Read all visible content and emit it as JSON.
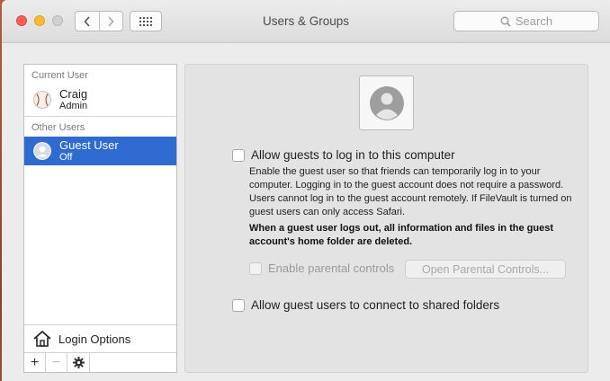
{
  "window": {
    "title": "Users & Groups",
    "search_placeholder": "Search"
  },
  "sidebar": {
    "current_user_header": "Current User",
    "current_user": {
      "name": "Craig",
      "role": "Admin"
    },
    "other_users_header": "Other Users",
    "guest_user": {
      "name": "Guest User",
      "status": "Off"
    },
    "login_options_label": "Login Options",
    "toolbar": {
      "add": "+",
      "remove": "−"
    }
  },
  "panel": {
    "allow_guest_login_label": "Allow guests to log in to this computer",
    "allow_guest_login_checked": false,
    "description": "Enable the guest user so that friends can temporarily log in to your computer. Logging in to the guest account does not require a password. Users cannot log in to the guest account remotely. If FileVault is turned on guest users can only access Safari.",
    "warning": "When a guest user logs out, all information and files in the guest account's home folder are deleted.",
    "parental_controls_label": "Enable parental controls",
    "parental_controls_checked": false,
    "open_parental_button": "Open Parental Controls...",
    "shared_folders_label": "Allow guest users to connect to shared folders",
    "shared_folders_checked": false
  },
  "colors": {
    "selection": "#2e6ad0",
    "close": "#fc5f57",
    "minimize": "#fdbc2e"
  }
}
